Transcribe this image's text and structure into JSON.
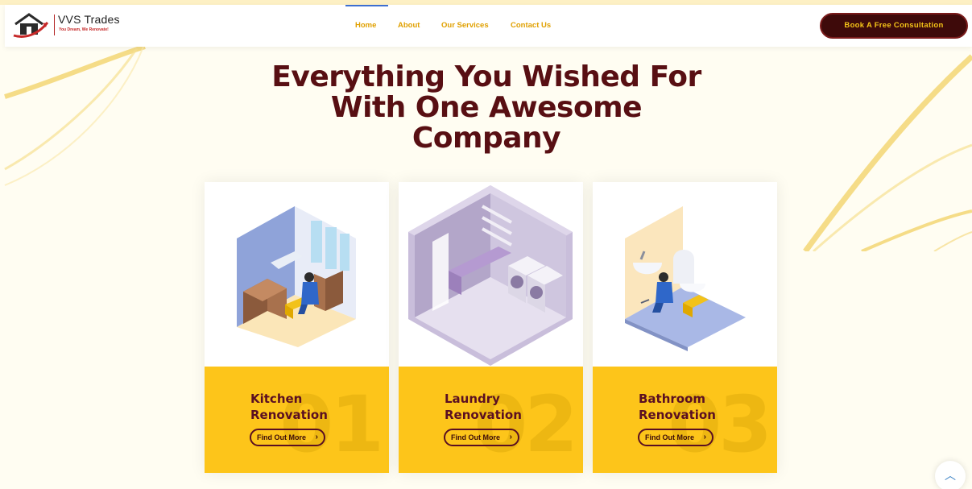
{
  "header": {
    "brand_name": "VVS Trades",
    "brand_tagline": "You Dream, We Renovate!",
    "nav": [
      {
        "label": "Home",
        "active": true
      },
      {
        "label": "About",
        "active": false
      },
      {
        "label": "Our Services",
        "active": false
      },
      {
        "label": "Contact Us",
        "active": false
      }
    ],
    "cta_label": "Book A Free Consultation"
  },
  "hero": {
    "title_lines": [
      "Everything You Wished For",
      "With One Awesome",
      "Company"
    ]
  },
  "cards": [
    {
      "title_line1": "Kitchen",
      "title_line2": "Renovation",
      "number": "01",
      "button_label": "Find Out More",
      "chevron": "›",
      "image_icon": "kitchen-renovation-illustration"
    },
    {
      "title_line1": "Laundry",
      "title_line2": "Renovation",
      "number": "02",
      "button_label": "Find Out More",
      "chevron": "›",
      "image_icon": "laundry-room-illustration"
    },
    {
      "title_line1": "Bathroom",
      "title_line2": "Renovation",
      "number": "03",
      "button_label": "Find Out More",
      "chevron": "›",
      "image_icon": "bathroom-renovation-illustration"
    }
  ],
  "scroll_top_icon": "chevron-up-icon",
  "scroll_top_glyph": "︿",
  "colors": {
    "accent_yellow": "#fdc51a",
    "maroon": "#580f13",
    "nav_text": "#e0a000",
    "cta_bg": "#3e0a0a"
  }
}
